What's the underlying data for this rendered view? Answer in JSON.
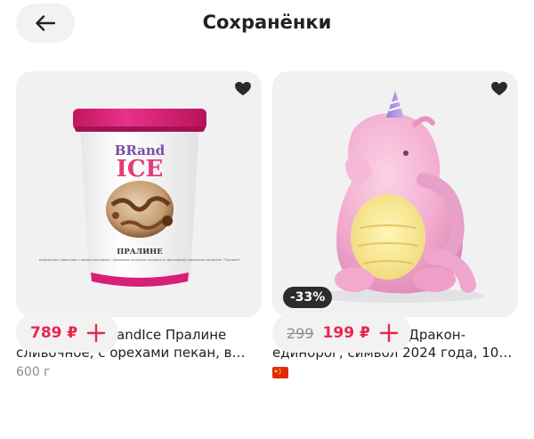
{
  "header": {
    "title": "Сохранёнки",
    "back_icon": "arrow-left-icon"
  },
  "products": [
    {
      "title": "Мороженое BrandIce Пралине сливочное, с орехами пекан, в ве...",
      "weight": "600 г",
      "price": "789 ₽",
      "image": {
        "brand_top": "BRand",
        "brand_bottom": "ICE",
        "flavor": "ПРАЛИНЕ",
        "description": "мороженое сливочное с ароматизатором\nс ореховым печеньем пралине и прослойкой\nсливочной карамели \"Пралине\""
      }
    },
    {
      "title": "Из Китая: Фигурка Дракон-единорог, символ 2024 года, 10 см",
      "old_price": "299",
      "price": "199 ₽",
      "discount": "-33%",
      "origin_flag": "china-flag-icon"
    }
  ],
  "colors": {
    "accent": "#e8264c",
    "chip_bg": "#f2f2f3",
    "card_bg": "#f1f1f2"
  }
}
